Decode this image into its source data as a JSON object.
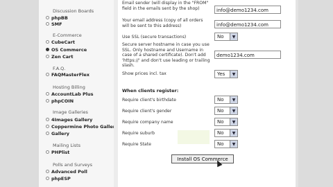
{
  "sidebar": {
    "sections": [
      {
        "title": "Discussion Boards",
        "items": [
          {
            "label": "phpBB",
            "selected": false
          },
          {
            "label": "SMF",
            "selected": false
          }
        ]
      },
      {
        "title": "E-Commerce",
        "items": [
          {
            "label": "CubeCart",
            "selected": false
          },
          {
            "label": "OS Commerce",
            "selected": true
          },
          {
            "label": "Zen Cart",
            "selected": false
          }
        ]
      },
      {
        "title": "F.A.Q.",
        "items": [
          {
            "label": "FAQMasterFlex",
            "selected": false
          }
        ]
      },
      {
        "title": "Hosting Billing",
        "items": [
          {
            "label": "AccountLab Plus",
            "selected": false
          },
          {
            "label": "phpCOIN",
            "selected": false
          }
        ]
      },
      {
        "title": "Image Galleries",
        "items": [
          {
            "label": "4Images Gallery",
            "selected": false
          },
          {
            "label": "Coppermine Photo Gallery",
            "selected": false
          },
          {
            "label": "Gallery",
            "selected": false
          }
        ]
      },
      {
        "title": "Mailing Lists",
        "items": [
          {
            "label": "PHPlist",
            "selected": false
          }
        ]
      },
      {
        "title": "Polls and Surveys",
        "items": [
          {
            "label": "Advanced Poll",
            "selected": false
          },
          {
            "label": "phpESP",
            "selected": false
          }
        ]
      }
    ]
  },
  "form": {
    "store_email_label": "Email sender (will display in the \"FROM\" field in the emails sent by the shop)",
    "store_email_value": "info@demo1234.com",
    "orders_email_label": "Your email address (copy of all orders will be sent to this address)",
    "orders_email_value": "info@demo1234.com",
    "ssl_label": "Use SSL (secure transactions)",
    "ssl_value": "No",
    "ssl_host_label": "Secure server hostname in case you use SSL. Only hostname and Username in case of a shared certificate). Don't add 'https://' and don't use leading or trailing slash.",
    "ssl_host_value": "demo1234.com",
    "prices_tax_label": "Show prices incl. tax",
    "prices_tax_value": "Yes",
    "clients_register_heading": "When clients register:",
    "require_birthdate_label": "Require client's birthdate",
    "require_birthdate_value": "No",
    "require_gender_label": "Require client's gender",
    "require_gender_value": "No",
    "require_company_label": "Require company name",
    "require_company_value": "No",
    "require_suburb_label": "Require suburb",
    "require_suburb_value": "No",
    "require_state_label": "Require State",
    "require_state_value": "No",
    "install_button_label": "Install OS Commerce"
  },
  "icons": {
    "bullet": "radio-bullet-icon",
    "dropdown": "chevron-down-icon",
    "cursor": "mouse-pointer-icon"
  }
}
